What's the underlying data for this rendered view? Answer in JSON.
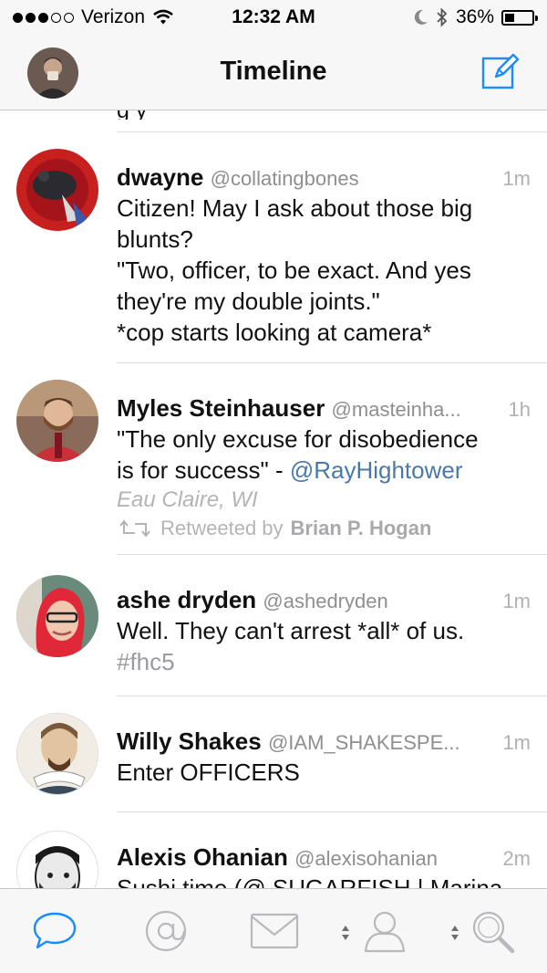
{
  "status": {
    "carrier": "Verizon",
    "time": "12:32 AM",
    "battery": "36%",
    "battery_level": 0.36
  },
  "nav": {
    "title": "Timeline"
  },
  "partial_text": "g          y",
  "tweets": [
    {
      "name": "dwayne",
      "handle": "@collatingbones",
      "time": "1m",
      "body": [
        "Citizen! May I ask about those big",
        "blunts?",
        "\"Two, officer, to be exact. And yes",
        "they're my double joints.\"",
        "*cop starts looking at camera*"
      ]
    },
    {
      "name": "Myles Steinhauser",
      "handle": "@masteinha...",
      "time": "1h",
      "body_line1": "\"The only excuse for disobedience",
      "body_line2": "is for success\" - ",
      "mention": "@RayHightower",
      "location": "Eau Claire, WI",
      "retweet_prefix": "Retweeted by",
      "retweeter": "Brian P. Hogan"
    },
    {
      "name": "ashe dryden",
      "handle": "@ashedryden",
      "time": "1m",
      "body": "Well. They can't arrest *all* of us.",
      "hashtag": "#fhc5"
    },
    {
      "name": "Willy Shakes",
      "handle": "@IAM_SHAKESPE...",
      "time": "1m",
      "body": "Enter OFFICERS"
    },
    {
      "name": "Alexis Ohanian",
      "handle": "@alexisohanian",
      "time": "2m",
      "body": "Sushi time (@ SUGARFISH | Marina"
    }
  ],
  "tabs": [
    "timeline-tab",
    "mentions-tab",
    "messages-tab",
    "profile-tab",
    "search-tab"
  ],
  "colors": {
    "accent": "#1a8cff",
    "mention": "#4a78a8",
    "inactive_icon": "#b8b8bd"
  }
}
